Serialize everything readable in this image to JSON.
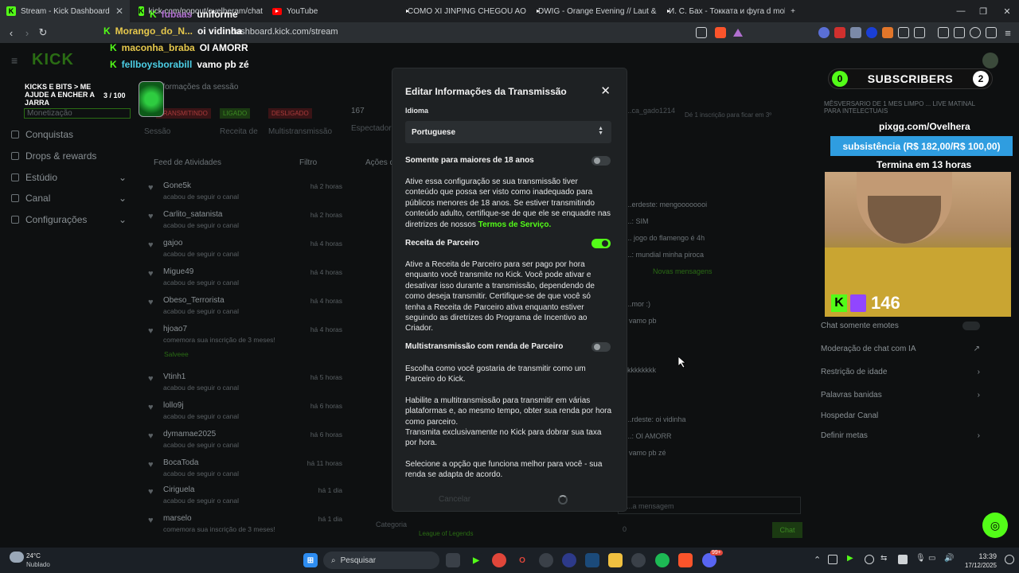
{
  "browser": {
    "tabs": [
      {
        "title": "Stream - Kick Dashboard",
        "icon": "kick-icon"
      },
      {
        "title": "kick.com/popout/ovelheram/chat",
        "icon": "kick-icon"
      },
      {
        "title": "YouTube",
        "icon": "youtube-icon"
      },
      {
        "title": "COMO XI JINPING CHEGOU AO POD",
        "icon": "youtube-icon"
      },
      {
        "title": "DWIG - Orange Evening // Laut & Lu",
        "icon": "youtube-icon"
      },
      {
        "title": "И. С. Бах - Токката и фуга d moll - Yo",
        "icon": "youtube-icon"
      }
    ],
    "url": "dashboard.kick.com/stream"
  },
  "stream_overlay": {
    "chat": [
      {
        "user": "fubaas",
        "message": "uniforme"
      },
      {
        "user": "Morango_do_N...",
        "message": "oi vidinha"
      },
      {
        "user": "maconha_braba",
        "message": "OI AMORR"
      },
      {
        "user": "fellboysborabill",
        "message": "vamo pb zé"
      }
    ],
    "goal": {
      "label": "KICKS E BITS > ME AJUDE A ENCHER A JARRA",
      "progress": "3 / 100"
    },
    "subscribers": {
      "label": "SUBSCRIBERS",
      "left": "0",
      "right": "2"
    },
    "pix": "pixgg.com/Ovelhera",
    "subsistencia": "subsistência (R$ 182,00/R$ 100,00)",
    "timer": "Termina em 13 horas",
    "follower_count": "146"
  },
  "sidebar": {
    "selected": "Monetização",
    "items": [
      "Conquistas",
      "Drops & rewards",
      "Estúdio",
      "Canal",
      "Configurações"
    ]
  },
  "session": {
    "title": "Informações da sessão",
    "badges": [
      "TRANSMITINDO",
      "LIGADO",
      "DESLIGADO"
    ],
    "labels": [
      "Sessão",
      "Receita de",
      "Multistransmissão",
      "Espectadores"
    ],
    "viewers": "167"
  },
  "feed": {
    "title": "Feed de Atividades",
    "filter": "Filtro",
    "actions_title": "Ações d",
    "rows": [
      {
        "name": "Gone5k",
        "sub": "acabou de seguir o canal",
        "time": "há 2 horas"
      },
      {
        "name": "Carlito_satanista",
        "sub": "acabou de seguir o canal",
        "time": "há 2 horas"
      },
      {
        "name": "gajoo",
        "sub": "acabou de seguir o canal",
        "time": "há 4 horas"
      },
      {
        "name": "Migue49",
        "sub": "acabou de seguir o canal",
        "time": "há 4 horas"
      },
      {
        "name": "Obeso_Terrorista",
        "sub": "acabou de seguir o canal",
        "time": "há 4 horas"
      },
      {
        "name": "hjoao7",
        "sub": "comemora sua inscrição de 3 meses!",
        "time": "há 4 horas"
      },
      {
        "name": "Vtinh1",
        "sub": "acabou de seguir o canal",
        "time": "há 5 horas"
      },
      {
        "name": "lollo9j",
        "sub": "acabou de seguir o canal",
        "time": "há 6 horas"
      },
      {
        "name": "dymamae2025",
        "sub": "acabou de seguir o canal",
        "time": "há 6 horas"
      },
      {
        "name": "BocaToda",
        "sub": "acabou de seguir o canal",
        "time": "há 11 horas"
      },
      {
        "name": "Ciriguela",
        "sub": "acabou de seguir o canal",
        "time": "há 1 dia"
      },
      {
        "name": "marselo",
        "sub": "comemora sua inscrição de 3 meses!",
        "time": "há 1 dia"
      }
    ],
    "salvee": "Salveee",
    "category_label": "Categoria",
    "category_value": "League of Legends"
  },
  "chat": {
    "top_user": "...ca_gado1214",
    "notice": "Dé 1 inscrição para ficar em 3º",
    "lines": [
      "...erdeste: mengoooooooi",
      "...: SIM",
      "... jogo do flamengo é 4h",
      "...: mundial minha piroca",
      "Novas mensagens",
      "...mor :)",
      "vamo pb",
      "kkkkkkkk",
      "...rdeste: oi vidinha",
      "...: OI AMORR",
      "vamo pb zé"
    ],
    "input_placeholder": "...a mensagem",
    "send": "Chat",
    "count": "0"
  },
  "right_panel": {
    "title": "MÊSVERSARIO DE 1 MES LIMPO ... LIVE MATINAL PARA INTELECTUAIS",
    "settings": [
      "Chat somente emotes",
      "Moderação de chat com IA",
      "Restrição de idade",
      "Palavras banidas",
      "Hospedar Canal",
      "Definir metas"
    ]
  },
  "modal": {
    "title": "Editar Informações da Transmissão",
    "language_label": "Idioma",
    "language_value": "Portuguese",
    "adult_label": "Somente para maiores de 18 anos",
    "adult_on": false,
    "adult_desc": "Ative essa configuração se sua transmissão tiver conteúdo que possa ser visto como inadequado para públicos menores de 18 anos. Se estiver transmitindo conteúdo adulto, certifique-se de que ele se enquadre nas diretrizes de nossos",
    "terms_link": "Termos de Serviço.",
    "partner_label": "Receita de Parceiro",
    "partner_on": true,
    "partner_desc": "Ative a Receita de Parceiro para ser pago por hora enquanto você transmite no Kick. Você pode ativar e desativar isso durante a transmissão, dependendo de como deseja transmitir. Certifique-se de que você só tenha a Receita de Parceiro ativa enquanto estiver seguindo as diretrizes do Programa de Incentivo ao Criador.",
    "multi_label": "Multistransmissão com renda de Parceiro",
    "multi_on": false,
    "multi_desc1": "Escolha como você gostaria de transmitir como um Parceiro do Kick.",
    "multi_desc2": "Habilite a multitransmissão para transmitir em várias plataformas e, ao mesmo tempo, obter sua renda por hora como parceiro.",
    "multi_desc3": "Transmita exclusivamente no Kick para dobrar sua taxa por hora.",
    "multi_desc4": "Selecione a opção que funciona melhor para você - sua renda se adapta de acordo.",
    "cancel": "Cancelar"
  },
  "taskbar": {
    "weather_temp": "24°C",
    "weather_desc": "Nublado",
    "search": "Pesquisar",
    "time": "13:39",
    "date": "17/12/2025",
    "badge": "99+"
  },
  "colors": {
    "kick_green": "#53fc18",
    "modal_bg": "#1e2123"
  }
}
